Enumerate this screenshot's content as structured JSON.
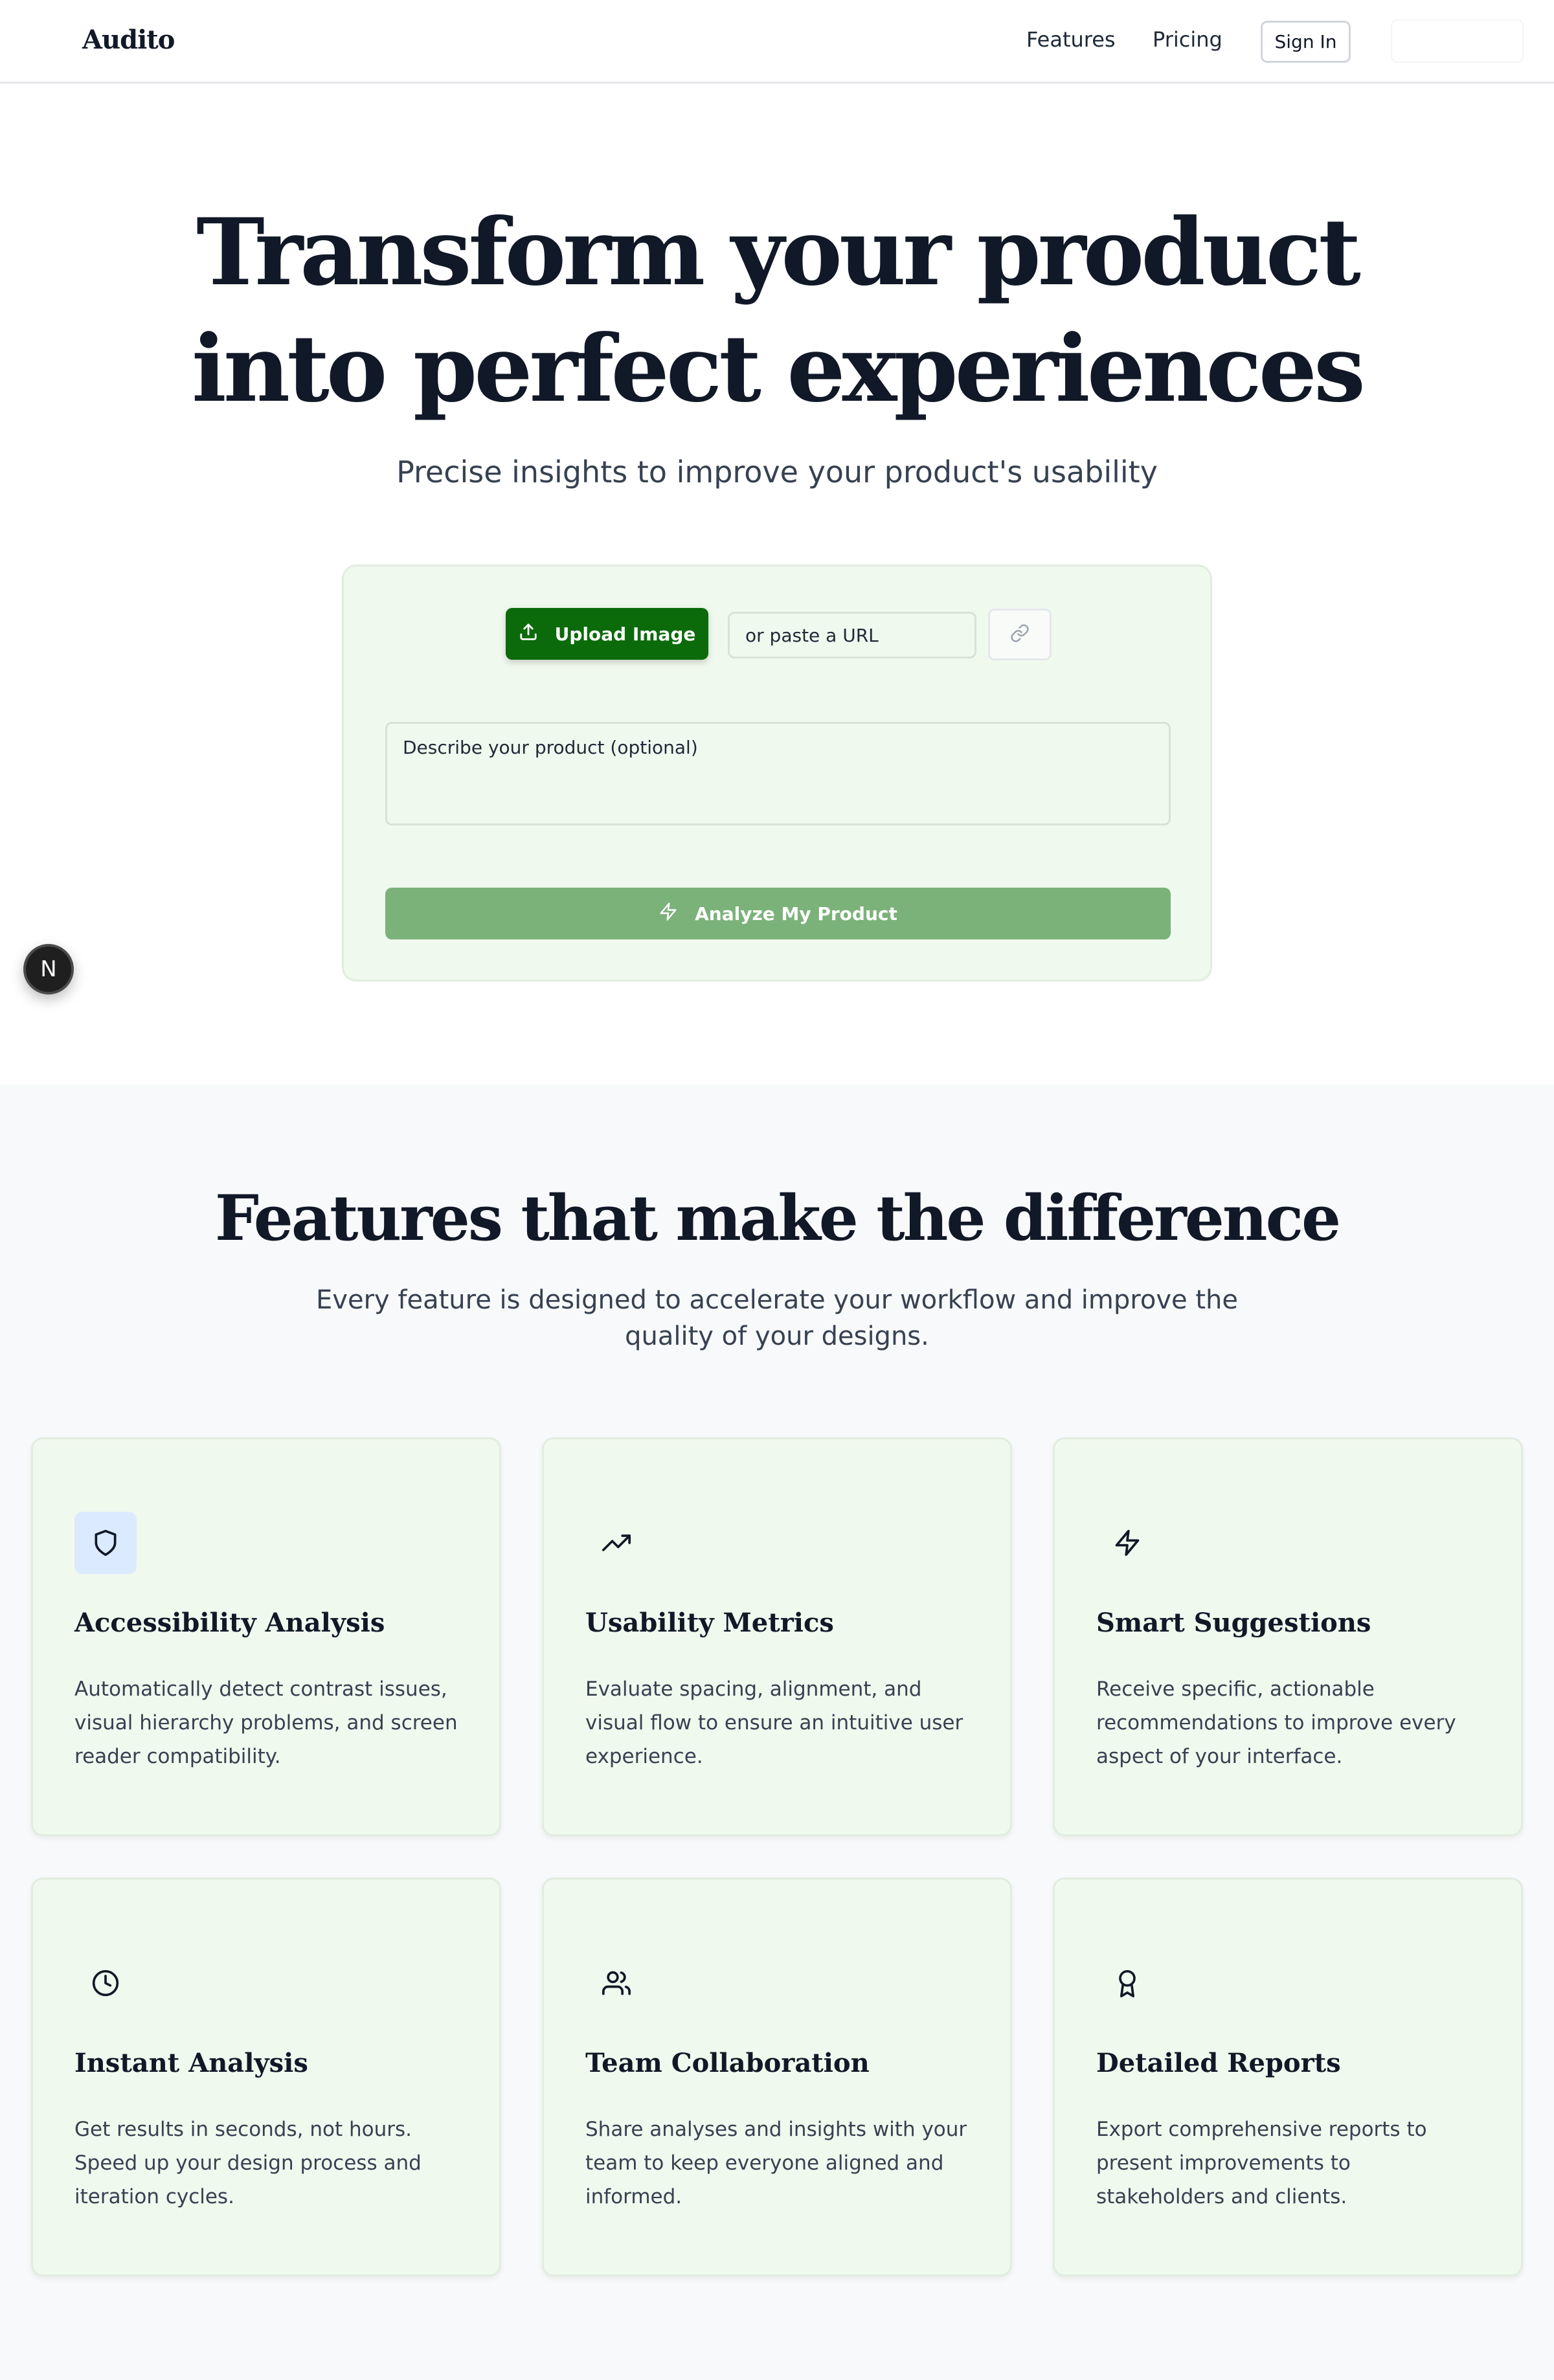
{
  "nav": {
    "logo": "Audito",
    "links": [
      "Features",
      "Pricing"
    ],
    "signin_label": "Sign In"
  },
  "hero": {
    "title_line1": "Transform your product",
    "title_line2": "into perfect experiences",
    "subtitle": "Precise insights to improve your product's usability"
  },
  "upload": {
    "upload_label": "Upload Image",
    "url_placeholder": "or paste a URL",
    "description_placeholder": "Describe your product (optional)",
    "analyze_label": "Analyze My Product"
  },
  "badge": {
    "letter": "N"
  },
  "features": {
    "title": "Features that make the difference",
    "subtitle": "Every feature is designed to accelerate your workflow and improve the quality of your designs.",
    "items": [
      {
        "icon": "shield-icon",
        "title": "Accessibility Analysis",
        "description": "Automatically detect contrast issues, visual hierarchy problems, and screen reader compatibility."
      },
      {
        "icon": "trending-up-icon",
        "title": "Usability Metrics",
        "description": "Evaluate spacing, alignment, and visual flow to ensure an intuitive user experience."
      },
      {
        "icon": "lightning-icon",
        "title": "Smart Suggestions",
        "description": "Receive specific, actionable recommendations to improve every aspect of your interface."
      },
      {
        "icon": "clock-icon",
        "title": "Instant Analysis",
        "description": "Get results in seconds, not hours. Speed up your design process and iteration cycles."
      },
      {
        "icon": "users-icon",
        "title": "Team Collaboration",
        "description": "Share analyses and insights with your team to keep everyone aligned and informed."
      },
      {
        "icon": "award-icon",
        "title": "Detailed Reports",
        "description": "Export comprehensive reports to present improvements to stakeholders and clients."
      }
    ]
  },
  "colors": {
    "primary_green": "#0b6b0b",
    "muted_green": "#7bb27a",
    "card_bg": "#f0f9ee",
    "heading": "#111827"
  }
}
